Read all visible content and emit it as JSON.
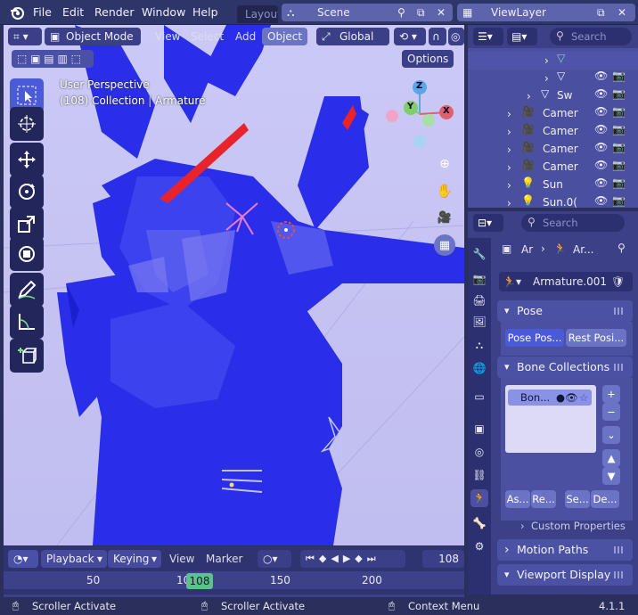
{
  "menu": {
    "items": [
      "File",
      "Edit",
      "Render",
      "Window",
      "Help"
    ],
    "workspace_tab": "Layout"
  },
  "scene": {
    "name": "Scene"
  },
  "view_layer": {
    "name": "ViewLayer"
  },
  "viewport": {
    "mode": "Object Mode",
    "menu": [
      "View",
      "Select",
      "Add",
      "Object"
    ],
    "transform": "Global",
    "options": "Options",
    "overlay_title": "User Perspective",
    "overlay_collection": "(108) Collection",
    "overlay_sep": " | ",
    "overlay_object": "Armature",
    "gizmo": {
      "z": "Z",
      "y": "Y",
      "x": "X"
    }
  },
  "outliner": {
    "search_placeholder": "Search",
    "rows": [
      {
        "label": "Sw"
      },
      {
        "label": "Camer"
      },
      {
        "label": "Camer"
      },
      {
        "label": "Camer"
      },
      {
        "label": "Camer"
      },
      {
        "label": "Sun"
      },
      {
        "label": "Sun.0("
      }
    ]
  },
  "properties": {
    "search_placeholder": "Search",
    "breadcrumb": [
      "Ar",
      "Ar..."
    ],
    "object_name": "Armature.001",
    "panels": {
      "pose": "Pose",
      "pose_position": "Pose Pos...",
      "rest_position": "Rest Posi...",
      "bone_collections": "Bone Collections",
      "bone_item": "Bon...",
      "assign": "As...",
      "remove": "Re...",
      "select": "Se...",
      "deselect": "De...",
      "custom_properties": "Custom Properties",
      "motion_paths": "Motion Paths",
      "viewport_display": "Viewport Display"
    }
  },
  "timeline": {
    "playback": "Playback",
    "keying": "Keying",
    "view": "View",
    "marker": "Marker",
    "current_frame": "108",
    "ticks": [
      "50",
      "10",
      "150",
      "200"
    ]
  },
  "status": {
    "left": "Scroller Activate",
    "middle": "Scroller Activate",
    "right": "Context Menu",
    "version": "4.1.1"
  },
  "colors": {
    "accent": "#4a5ad8",
    "frame": "#5ec08c",
    "bg": "#2a2f5c"
  }
}
